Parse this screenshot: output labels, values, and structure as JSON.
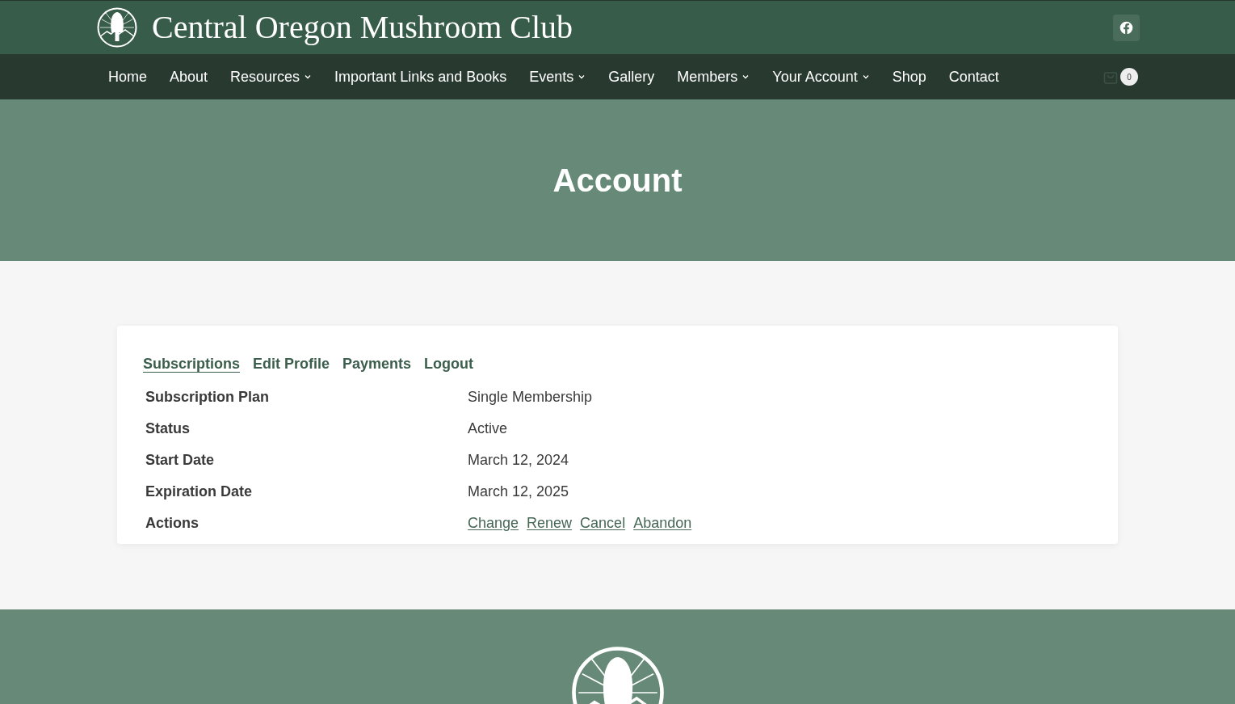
{
  "site": {
    "title": "Central Oregon Mushroom Club",
    "cart_count": "0"
  },
  "nav": [
    {
      "label": "Home",
      "has_dropdown": false
    },
    {
      "label": "About",
      "has_dropdown": false
    },
    {
      "label": "Resources",
      "has_dropdown": true
    },
    {
      "label": "Important Links and Books",
      "has_dropdown": false
    },
    {
      "label": "Events",
      "has_dropdown": true
    },
    {
      "label": "Gallery",
      "has_dropdown": false
    },
    {
      "label": "Members",
      "has_dropdown": true
    },
    {
      "label": "Your Account",
      "has_dropdown": true
    },
    {
      "label": "Shop",
      "has_dropdown": false
    },
    {
      "label": "Contact",
      "has_dropdown": false
    }
  ],
  "hero": {
    "title": "Account"
  },
  "tabs": [
    {
      "label": "Subscriptions",
      "selected": true
    },
    {
      "label": "Edit Profile",
      "selected": false
    },
    {
      "label": "Payments",
      "selected": false
    },
    {
      "label": "Logout",
      "selected": false
    }
  ],
  "details": [
    {
      "label": "Subscription Plan",
      "value": "Single Membership"
    },
    {
      "label": "Status",
      "value": "Active"
    },
    {
      "label": "Start Date",
      "value": "March 12, 2024"
    },
    {
      "label": "Expiration Date",
      "value": "March 12, 2025"
    }
  ],
  "actions": {
    "label": "Actions",
    "links": [
      "Change",
      "Renew",
      "Cancel",
      "Abandon"
    ]
  }
}
